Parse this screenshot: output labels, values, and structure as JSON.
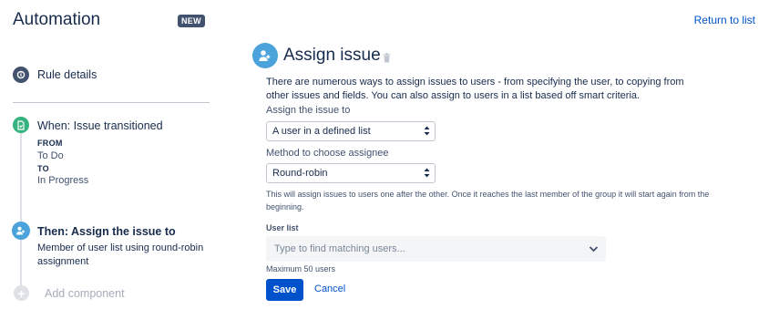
{
  "header": {
    "title": "Automation",
    "badge": "NEW",
    "return_link": "Return to list"
  },
  "sidebar": {
    "rule_details": "Rule details",
    "trigger": {
      "title": "When: Issue transitioned",
      "from_label": "FROM",
      "from_value": "To Do",
      "to_label": "TO",
      "to_value": "In Progress"
    },
    "action": {
      "title": "Then: Assign the issue to",
      "description": "Member of user list using round-robin assignment"
    },
    "add_component": "Add component"
  },
  "main": {
    "title": "Assign issue",
    "description": "There are numerous ways to assign issues to users - from specifying the user, to copying from other issues and fields. You can also assign to users in a list based off smart criteria.",
    "assign_label": "Assign the issue to",
    "assign_value": "A user in a defined list",
    "method_label": "Method to choose assignee",
    "method_value": "Round-robin",
    "method_help": "This will assign issues to users one after the other. Once it reaches the last member of the group it will start again from the beginning.",
    "user_list_label": "User list",
    "user_list_placeholder": "Type to find matching users...",
    "max_users": "Maximum 50 users",
    "save_label": "Save",
    "cancel_label": "Cancel"
  },
  "icons": {
    "rule": "info-icon",
    "trigger": "document-icon",
    "action": "assignee-icon",
    "add": "plus-icon",
    "delete": "trash-icon",
    "dropdown": "chevron-down-icon"
  },
  "colors": {
    "primary": "#0052cc",
    "trigger_green": "#36b37e",
    "action_blue": "#4ca3dc",
    "dark": "#42526e"
  }
}
